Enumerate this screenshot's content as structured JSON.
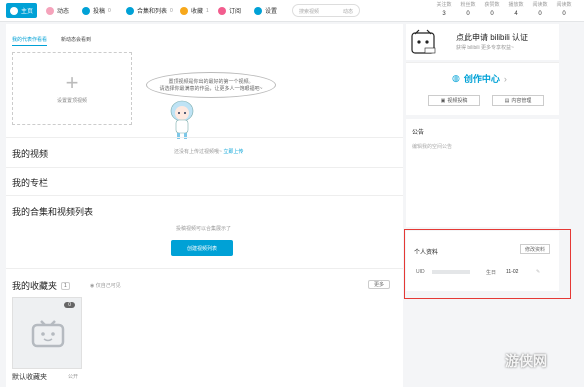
{
  "nav": {
    "tabs": [
      {
        "label": "主页",
        "count": "",
        "icon": "home-icon",
        "color": "#ffffff",
        "active": true
      },
      {
        "label": "动态",
        "count": "",
        "icon": "dynamic-icon",
        "color": "#f5a3bb",
        "active": false
      },
      {
        "label": "投稿",
        "count": "0",
        "icon": "upload-icon",
        "color": "#00a1d6",
        "active": false
      },
      {
        "label": "合集和列表",
        "count": "0",
        "icon": "collection-icon",
        "color": "#00a1d6",
        "active": false
      },
      {
        "label": "收藏",
        "count": "1",
        "icon": "star-icon",
        "color": "#f7a81b",
        "active": false
      },
      {
        "label": "订阅",
        "count": "",
        "icon": "heart-icon",
        "color": "#f25d8e",
        "active": false
      },
      {
        "label": "设置",
        "count": "",
        "icon": "gear-icon",
        "color": "#00a1d6",
        "active": false
      }
    ],
    "search_placeholder": "搜索视频",
    "search_hint": "动态",
    "stats": [
      {
        "label": "关注数",
        "value": "3"
      },
      {
        "label": "粉丝数",
        "value": "0"
      },
      {
        "label": "获赞数",
        "value": "0"
      },
      {
        "label": "播放数",
        "value": "4"
      },
      {
        "label": "阅读数",
        "value": "0"
      },
      {
        "label": "阅读数",
        "value": "0"
      }
    ]
  },
  "representative": {
    "tab_active": "我的代表作看看",
    "tab_other": "新动态会看到",
    "box_label": "设置置顶视频",
    "bubble_line1": "置顶视频是你出的最好的第一个视频。",
    "bubble_line2": "请选择你最满意的作品，让更多人一饱眼福吧~"
  },
  "sections": {
    "videos_title": "我的视频",
    "videos_note": "还没有上传过视频哦~",
    "videos_link": "立即上传",
    "column_title": "我的专栏",
    "collections_title": "我的合集和视频列表",
    "collections_note": "投稿视频可以合集展示了",
    "create_button": "创建视频列表",
    "favorites_title": "我的收藏夹",
    "favorites_count": "1",
    "favorites_privacy": "仅自己可见",
    "more_button": "更多",
    "fav_card_badge": "0",
    "fav_card_name": "默认收藏夹",
    "fav_card_status": "公开"
  },
  "side": {
    "apply_title": "点此申请 bilibili 认证",
    "apply_sub": "获得 bilibili 更多专享权益~",
    "creator_center": "创作中心",
    "video_submit": "视频投稿",
    "content_manage": "内容管理",
    "notice_title": "公告",
    "notice_body": "编辑我的空间公告",
    "profile_title": "个人资料",
    "edit_button": "修改资料",
    "uid_label": "UID",
    "birthday_label": "生日",
    "birthday_value": "11-02"
  },
  "watermark": "游侠网",
  "colors": {
    "accent": "#00a1d6",
    "highlight": "#e53935"
  }
}
